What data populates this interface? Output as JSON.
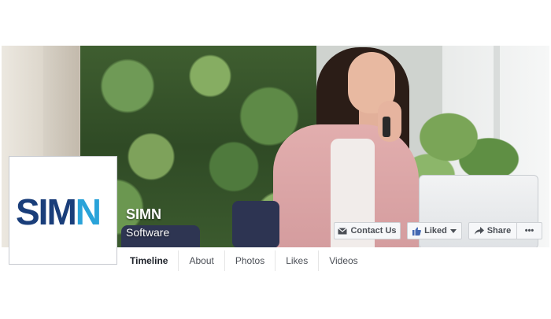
{
  "page": {
    "name": "SIMN",
    "category": "Software"
  },
  "logo": {
    "text_main": "SIM",
    "text_accent": "N",
    "colors": {
      "main": "#1a3e7a",
      "accent": "#2aa3d9"
    }
  },
  "actions": {
    "contact_label": "Contact Us",
    "liked_label": "Liked",
    "share_label": "Share",
    "more_label": "•••"
  },
  "tabs": [
    {
      "label": "Timeline",
      "active": true
    },
    {
      "label": "About"
    },
    {
      "label": "Photos"
    },
    {
      "label": "Likes"
    },
    {
      "label": "Videos"
    }
  ],
  "icons": {
    "contact": "envelope-icon",
    "liked": "thumbs-up-icon",
    "liked_dropdown": "caret-down-icon",
    "share": "share-arrow-icon"
  },
  "colors": {
    "accent": "#4267b2",
    "text": "#4b4f56"
  }
}
